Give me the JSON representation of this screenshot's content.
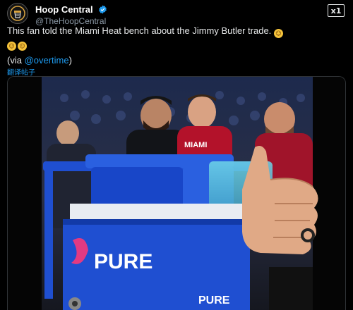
{
  "account": {
    "display_name": "Hoop Central",
    "handle": "@TheHoopCentral",
    "avatar_icon": "hoop-central-logo-icon",
    "verified_icon": "verified-badge-icon"
  },
  "header_action": {
    "label": "x1",
    "icon": "grok-icon"
  },
  "tweet": {
    "text": "This fan told the Miami Heat bench about the Jimmy Butler trade.",
    "emojis": [
      "laughing-face-emoji",
      "laughing-face-emoji",
      "laughing-face-emoji"
    ],
    "via_prefix": "(via ",
    "via_mention": "@overtime",
    "via_suffix": ")",
    "translate_label": "翻译帖子"
  },
  "media": {
    "cooler_brand": "PURE",
    "cooler_brand_small": "PURE",
    "jersey_text": "MIAMI"
  },
  "colors": {
    "link": "#1d9bf0",
    "text": "#e7e9ea",
    "muted": "#8b98a5",
    "cooler_blue": "#1f4fd1",
    "heat_red": "#b3122a"
  }
}
